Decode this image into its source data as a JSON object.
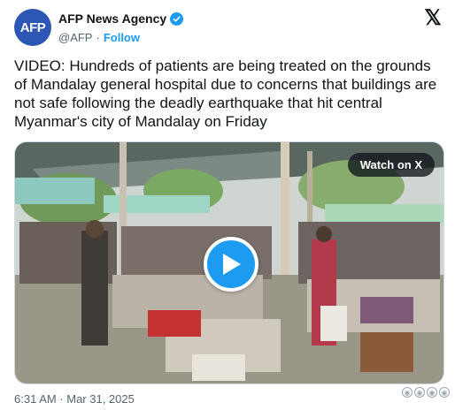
{
  "author": {
    "avatar_text": "AFP",
    "display_name": "AFP News Agency",
    "handle": "@AFP",
    "separator": "·",
    "follow_label": "Follow"
  },
  "x_logo": "𝕏",
  "tweet": {
    "text": "VIDEO:  Hundreds of patients are being treated on the grounds of Mandalay general hospital due to concerns that buildings are not safe following the deadly earthquake that hit central Myanmar's city of Mandalay on Friday"
  },
  "media": {
    "watch_label": "Watch on X",
    "icon": "play-icon"
  },
  "footer": {
    "timestamp": "6:31 AM · Mar 31, 2025"
  },
  "colors": {
    "accent": "#1d9bf0",
    "avatar_bg": "#2d57b5",
    "muted_text": "#536471"
  }
}
